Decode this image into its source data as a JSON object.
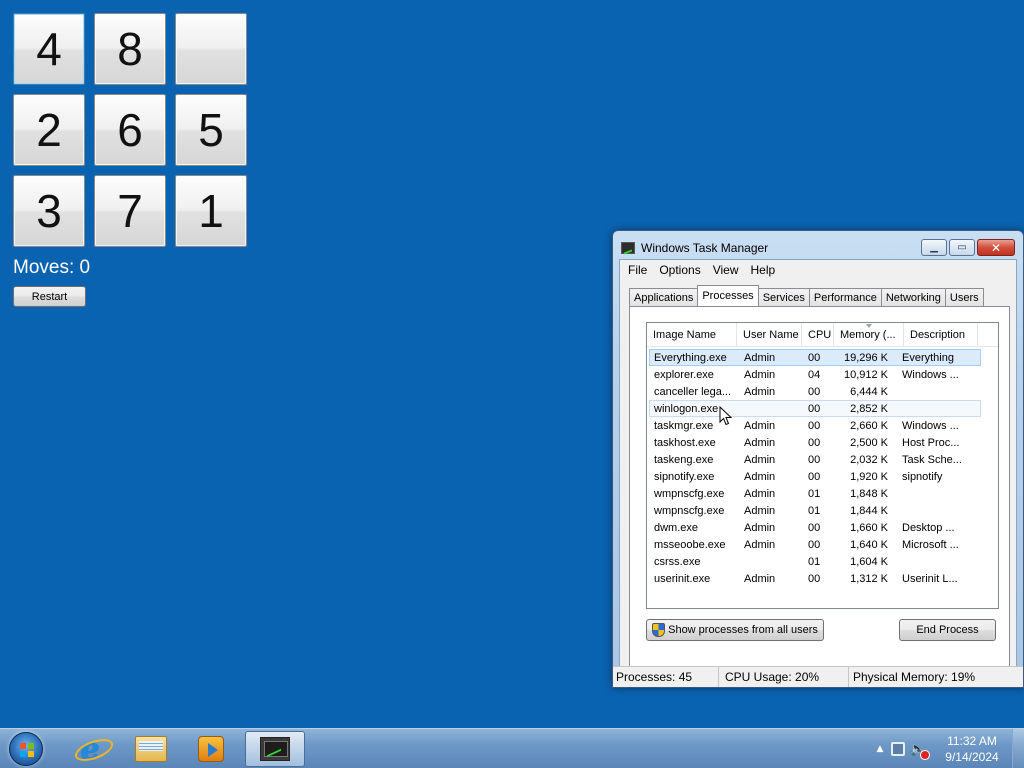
{
  "puzzle": {
    "tiles": [
      "4",
      "8",
      "",
      "2",
      "6",
      "5",
      "3",
      "7",
      "1"
    ],
    "moves_text": "Moves: 0",
    "restart_label": "Restart"
  },
  "task_manager": {
    "title": "Windows Task Manager",
    "menu": [
      "File",
      "Options",
      "View",
      "Help"
    ],
    "tabs": [
      "Applications",
      "Processes",
      "Services",
      "Performance",
      "Networking",
      "Users"
    ],
    "selected_tab": "Processes",
    "columns": [
      "Image Name",
      "User Name",
      "CPU",
      "Memory (...",
      "Description"
    ],
    "rows": [
      {
        "name": "Everything.exe",
        "user": "Admin",
        "cpu": "00",
        "mem": "19,296 K",
        "desc": "Everything"
      },
      {
        "name": "explorer.exe",
        "user": "Admin",
        "cpu": "04",
        "mem": "10,912 K",
        "desc": "Windows ..."
      },
      {
        "name": "canceller lega...",
        "user": "Admin",
        "cpu": "00",
        "mem": "6,444 K",
        "desc": ""
      },
      {
        "name": "winlogon.exe",
        "user": "",
        "cpu": "00",
        "mem": "2,852 K",
        "desc": ""
      },
      {
        "name": "taskmgr.exe",
        "user": "Admin",
        "cpu": "00",
        "mem": "2,660 K",
        "desc": "Windows ..."
      },
      {
        "name": "taskhost.exe",
        "user": "Admin",
        "cpu": "00",
        "mem": "2,500 K",
        "desc": "Host Proc..."
      },
      {
        "name": "taskeng.exe",
        "user": "Admin",
        "cpu": "00",
        "mem": "2,032 K",
        "desc": "Task Sche..."
      },
      {
        "name": "sipnotify.exe",
        "user": "Admin",
        "cpu": "00",
        "mem": "1,920 K",
        "desc": "sipnotify"
      },
      {
        "name": "wmpnscfg.exe",
        "user": "Admin",
        "cpu": "01",
        "mem": "1,848 K",
        "desc": ""
      },
      {
        "name": "wmpnscfg.exe",
        "user": "Admin",
        "cpu": "01",
        "mem": "1,844 K",
        "desc": ""
      },
      {
        "name": "dwm.exe",
        "user": "Admin",
        "cpu": "00",
        "mem": "1,660 K",
        "desc": "Desktop ..."
      },
      {
        "name": "msseoobe.exe",
        "user": "Admin",
        "cpu": "00",
        "mem": "1,640 K",
        "desc": "Microsoft ..."
      },
      {
        "name": "csrss.exe",
        "user": "",
        "cpu": "01",
        "mem": "1,604 K",
        "desc": ""
      },
      {
        "name": "userinit.exe",
        "user": "Admin",
        "cpu": "00",
        "mem": "1,312 K",
        "desc": "Userinit L..."
      }
    ],
    "show_all_label": "Show processes from all users",
    "end_process_label": "End Process",
    "status": {
      "processes": "Processes: 45",
      "cpu": "CPU Usage: 20%",
      "memory": "Physical Memory: 19%"
    }
  },
  "taskbar": {
    "pinned": [
      "internet-explorer-icon",
      "folder-icon",
      "media-player-icon",
      "task-manager-icon"
    ],
    "clock_time": "11:32 AM",
    "clock_date": "9/14/2024"
  },
  "colors": {
    "desktop": "#0a63b1",
    "row_selected": "#dcebfc"
  }
}
